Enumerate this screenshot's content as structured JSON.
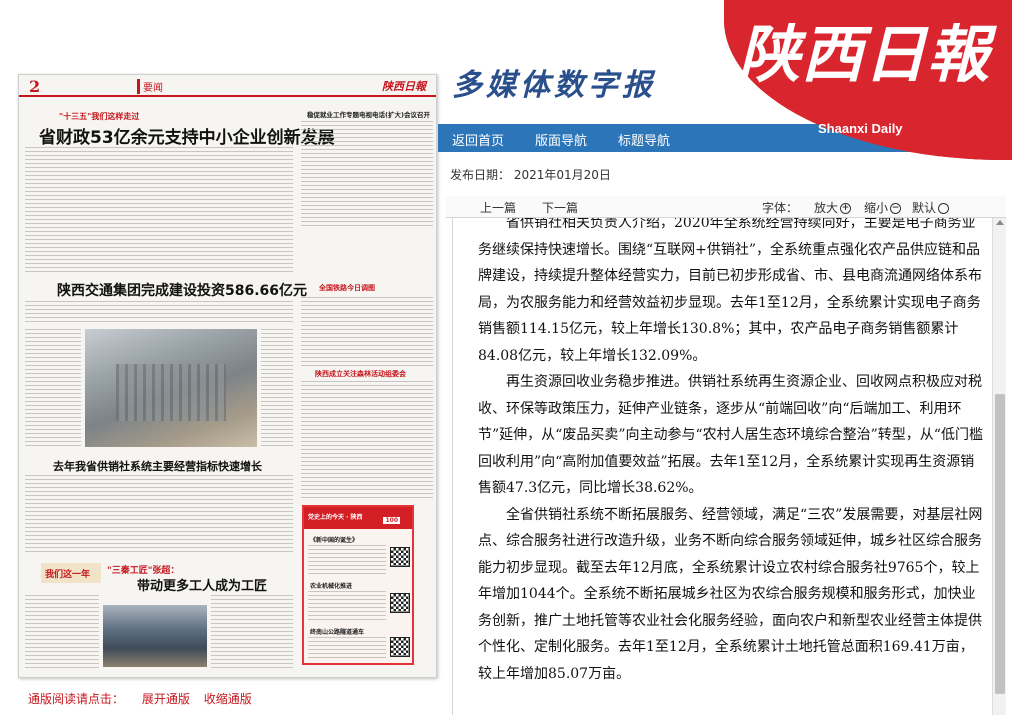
{
  "paper": {
    "page_number": "2",
    "section": "要闻",
    "logo_text": "陕西日報",
    "kicker": "\"十三五\"我们这样走过",
    "headline_main": "省财政53亿余元支持中小企业创新发展",
    "headline_2": "陕西交通集团完成建设投资586.66亿元",
    "headline_3": "去年我省供销社系统主要经营指标快速增长",
    "headline_4_kicker": "\"三秦工匠\"张超：",
    "headline_4": "带动更多工人成为工匠",
    "right_col_head": "稳促就业工作专题电视电话(扩大)会议召开",
    "bar_head_1": "全国铁路今日调图",
    "bar_head_2": "陕西成立关注森林活动组委会",
    "yellow_tag": "我们这一年",
    "ad_title": "党史上的今天 · 陕西",
    "ad_badge": "100",
    "ad_sub_1": "《新中国的诞生》",
    "ad_sub_2": "农业机械化推进",
    "ad_sub_3": "终南山公路隧道通车"
  },
  "bottom": {
    "label": "通版阅读请点击：",
    "link_expand": "展开通版",
    "link_collapse": "收缩通版"
  },
  "brand": {
    "subtitle": "多媒体数字报",
    "logo": "陕西日報",
    "english": "Shaanxi Daily"
  },
  "nav": {
    "items": [
      "返回首页",
      "版面导航",
      "标题导航"
    ]
  },
  "date": {
    "label": "发布日期：",
    "value": "2021年01月20日"
  },
  "toolbar": {
    "prev": "上一篇",
    "next": "下一篇",
    "font_label": "字体：",
    "enlarge": "放大",
    "shrink": "缩小",
    "default": "默认"
  },
  "article": {
    "paragraphs": [
      "省供销社相关负责人介绍，2020年全系统经营持续向好，主要是电子商务业务继续保持快速增长。围绕“互联网+供销社”，全系统重点强化农产品供应链和品牌建设，持续提升整体经营实力，目前已初步形成省、市、县电商流通网络体系布局，为农服务能力和经营效益初步显现。去年1至12月，全系统累计实现电子商务销售额114.15亿元，较上年增长130.8%；其中，农产品电子商务销售额累计84.08亿元，较上年增长132.09%。",
      "再生资源回收业务稳步推进。供销社系统再生资源企业、回收网点积极应对税收、环保等政策压力，延伸产业链条，逐步从“前端回收”向“后端加工、利用环节”延伸，从“废品买卖”向主动参与“农村人居生态环境综合整治”转型，从“低门槛回收利用”向“高附加值要效益”拓展。去年1至12月，全系统累计实现再生资源销售额47.3亿元，同比增长38.62%。",
      "全省供销社系统不断拓展服务、经营领域，满足“三农”发展需要，对基层社网点、综合服务社进行改造升级，业务不断向综合服务领域延伸，城乡社区综合服务能力初步显现。截至去年12月底，全系统累计设立农村综合服务社9765个，较上年增加1044个。全系统不断拓展城乡社区为农综合服务规模和服务形式，加快业务创新，推广土地托管等农业社会化服务经验，面向农户和新型农业经营主体提供个性化、定制化服务。去年1至12月，全系统累计土地托管总面积169.41万亩，较上年增加85.07万亩。"
    ]
  }
}
